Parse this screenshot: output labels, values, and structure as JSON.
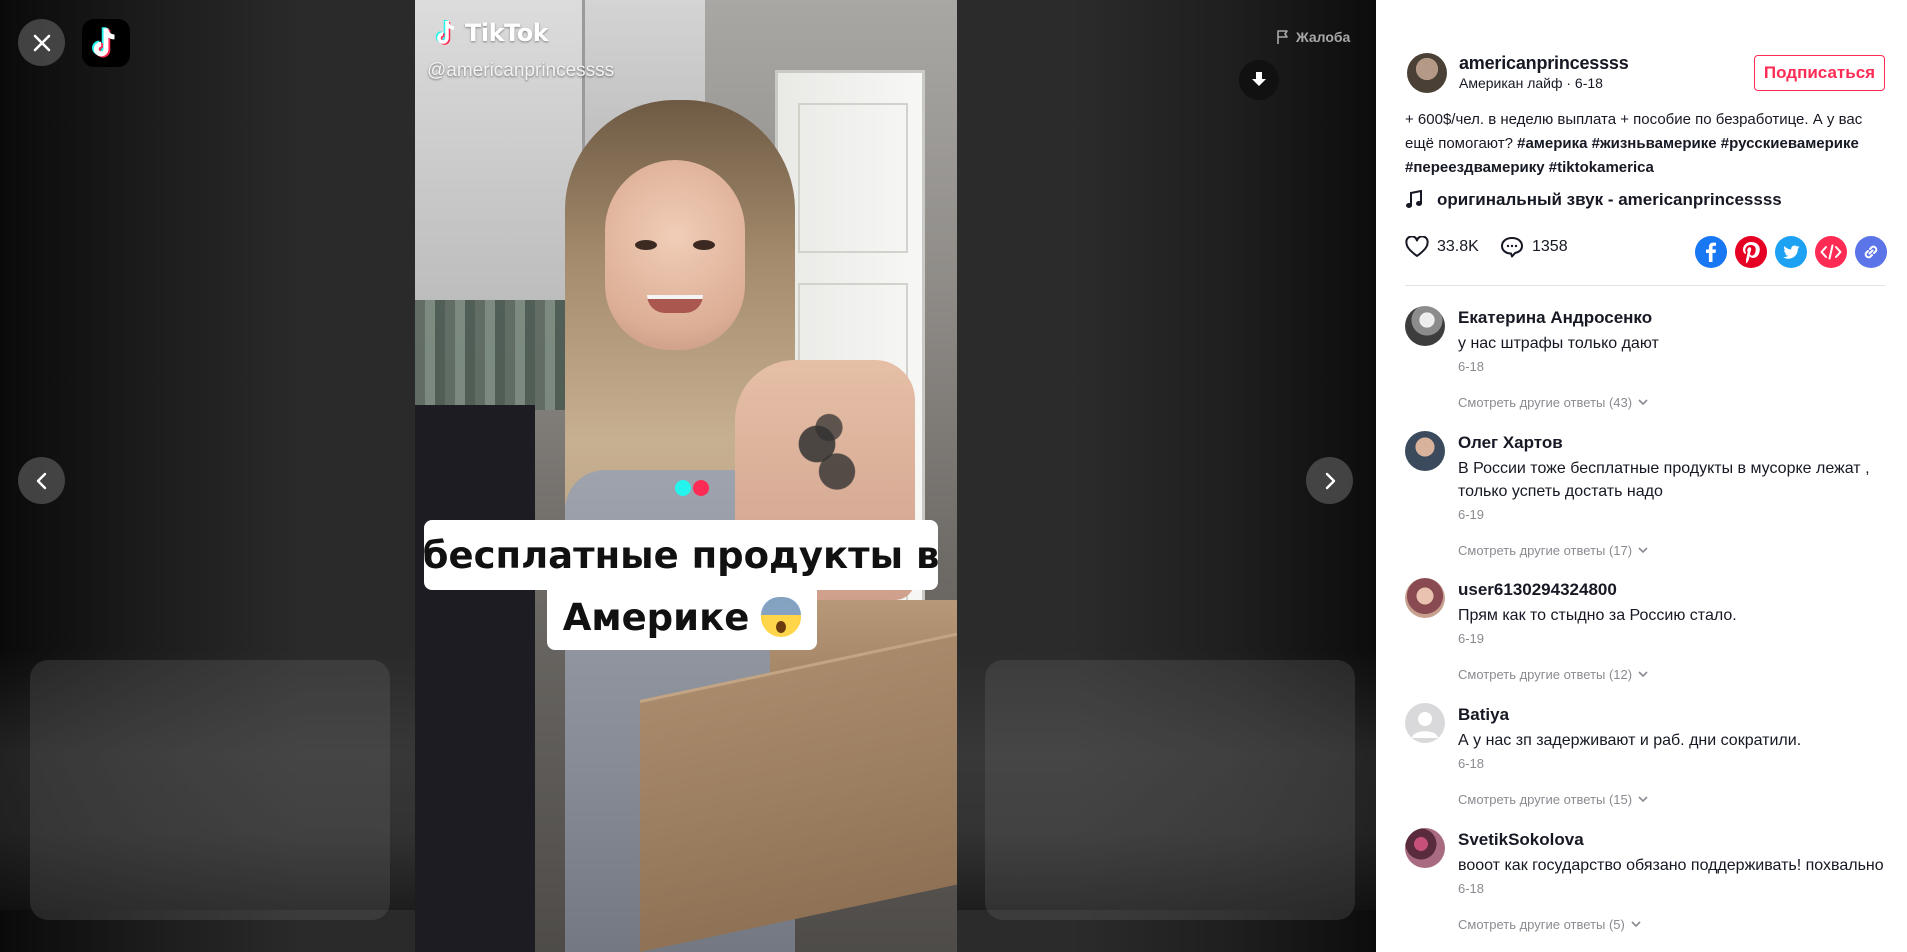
{
  "video": {
    "watermark_brand": "TikTok",
    "watermark_handle": "@americanprincessss",
    "caption_line1": "бесплатные продукты в",
    "caption_line2": "Америке",
    "report_label": "Жалоба",
    "loader_colors": [
      "#25f4ee",
      "#fe2c55"
    ]
  },
  "author": {
    "username": "americanprincessss",
    "subtitle": "Американ лайф · 6-18",
    "follow_label": "Подписаться"
  },
  "description": {
    "text": "+ 600$/чел. в неделю выплата + пособие по безработице. А у вас ещё помогают?",
    "tags": [
      "#америка",
      "#жизньвамерике",
      "#русскиевамерике",
      "#переездвамерику",
      "#tiktokamerica"
    ]
  },
  "sound": {
    "label": "оригинальный звук - americanprincessss"
  },
  "stats": {
    "likes": "33.8K",
    "comments": "1358"
  },
  "share_icons": [
    {
      "name": "facebook-icon",
      "color": "#1877f2"
    },
    {
      "name": "pinterest-icon",
      "color": "#e60023"
    },
    {
      "name": "twitter-icon",
      "color": "#1da1f2"
    },
    {
      "name": "embed-icon",
      "color": "#fe2c55"
    },
    {
      "name": "copy-link-icon",
      "color": "#5b74e8"
    }
  ],
  "comments": [
    {
      "name": "Екатерина Андросенко",
      "text": "у нас штрафы только дают",
      "date": "6-18",
      "replies": "Смотреть другие ответы (43)"
    },
    {
      "name": "Олег Хартов",
      "text": "В России тоже бесплатные продукты в мусорке лежат , только успеть достать надо",
      "date": "6-19",
      "replies": "Смотреть другие ответы (17)"
    },
    {
      "name": "user6130294324800",
      "text": "Прям как то стыдно за Россию стало.",
      "date": "6-19",
      "replies": "Смотреть другие ответы (12)"
    },
    {
      "name": "Batiya",
      "text": "А у нас зп задерживают и раб. дни сократили.",
      "date": "6-18",
      "replies": "Смотреть другие ответы (15)"
    },
    {
      "name": "SvetikSokolova",
      "text": "вооот как государство обязано поддерживать! похвально",
      "date": "6-18",
      "replies": "Смотреть другие ответы (5)"
    }
  ],
  "colors": {
    "accent": "#fe2c55",
    "text": "#161823",
    "muted": "#8a8b91"
  }
}
